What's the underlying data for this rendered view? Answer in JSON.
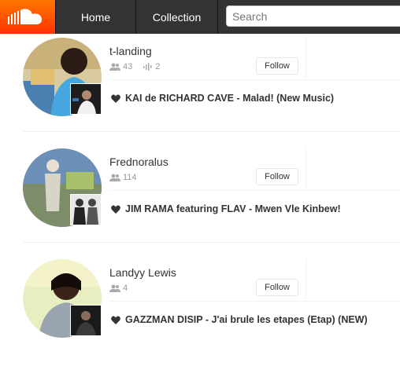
{
  "header": {
    "home_label": "Home",
    "collection_label": "Collection",
    "search_placeholder": "Search",
    "brand_color": "#ff5500"
  },
  "feed": [
    {
      "username": "t-landing",
      "followers": "43",
      "tracks": "2",
      "follow_label": "Follow",
      "liked_track": "KAI de RICHARD CAVE - Malad! (New Music)"
    },
    {
      "username": "Frednoralus",
      "followers": "114",
      "follow_label": "Follow",
      "liked_track": "JIM RAMA featuring FLAV - Mwen Vle Kinbew!"
    },
    {
      "username": "Landyy Lewis",
      "followers": "4",
      "follow_label": "Follow",
      "liked_track": "GAZZMAN DISIP - J'ai brule les etapes (Etap) (NEW)"
    }
  ]
}
